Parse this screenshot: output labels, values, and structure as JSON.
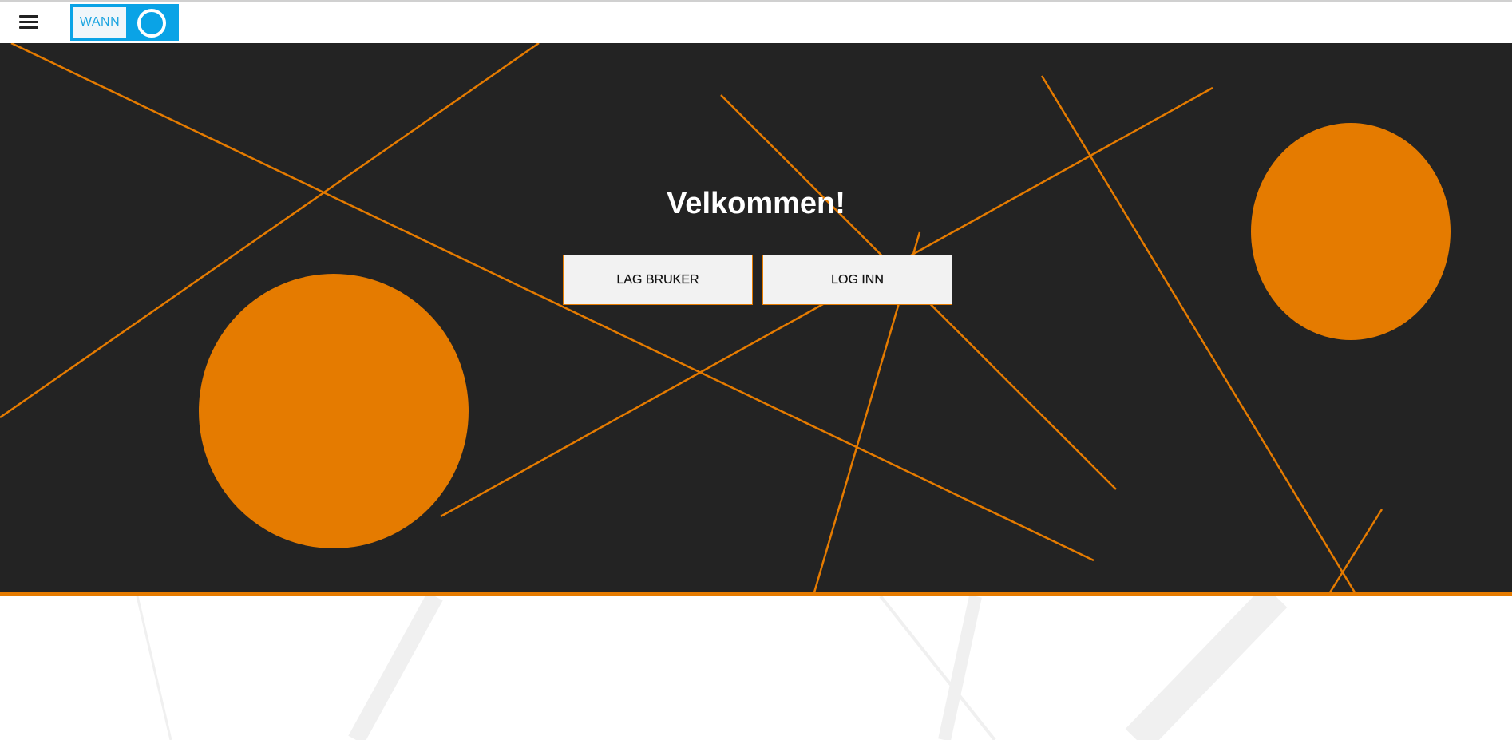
{
  "header": {
    "menu_icon": "hamburger-menu-icon",
    "logo": {
      "text": "WANN",
      "ring_icon": "ring-icon",
      "brand_color": "#0aa3e6"
    }
  },
  "hero": {
    "title": "Velkommen!",
    "buttons": {
      "signup_label": "LAG BRUKER",
      "login_label": "LOG INN"
    },
    "colors": {
      "background": "#232323",
      "accent": "#e57b00"
    }
  }
}
